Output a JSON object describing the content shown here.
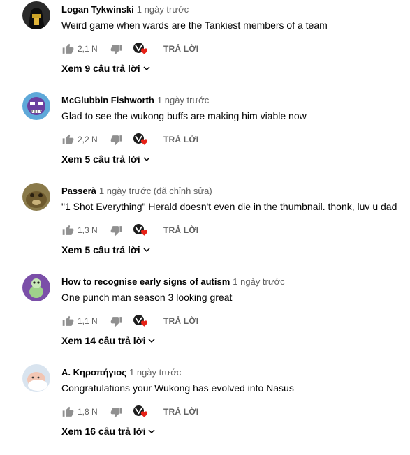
{
  "colors": {
    "heart": "#e62117",
    "muted": "#606060",
    "text": "#030303"
  },
  "comments": [
    {
      "author": "Logan Tykwinski",
      "time": "1 ngày trước",
      "text": "Weird game when wards are the Tankiest members of a team",
      "likes": "2,1 N",
      "reply_label": "TRẢ LỜI",
      "replies_label": "Xem 9 câu trả lời",
      "avatar": "masked-hood-avatar"
    },
    {
      "author": "McGlubbin Fishworth",
      "time": "1 ngày trước",
      "text": "Glad to see the wukong buffs are making him viable now",
      "likes": "2,2 N",
      "reply_label": "TRẢ LỜI",
      "replies_label": "Xem 5 câu trả lời",
      "avatar": "purple-cartoon-avatar"
    },
    {
      "author": "Passerà",
      "time": "1 ngày trước (đã chỉnh sửa)",
      "text": "\"1 Shot Everything\" Herald doesn't even die in the thumbnail. thonk, luv u dad",
      "likes": "1,3 N",
      "reply_label": "TRẢ LỜI",
      "replies_label": "Xem 5 câu trả lời",
      "avatar": "brown-animal-avatar"
    },
    {
      "author": "How to recognise early signs of autism",
      "time": "1 ngày trước",
      "text": "One punch man season 3 looking great",
      "likes": "1,1 N",
      "reply_label": "TRẢ LỜI",
      "replies_label": "Xem 14 câu trả lời",
      "avatar": "purple-character-avatar"
    },
    {
      "author": "A. Κηροπήγιος",
      "time": "1 ngày trước",
      "text": "Congratulations your Wukong has evolved into Nasus",
      "likes": "1,8 N",
      "reply_label": "TRẢ LỜI",
      "replies_label": "Xem 16 câu trả lời",
      "avatar": "baby-photo-avatar"
    }
  ]
}
